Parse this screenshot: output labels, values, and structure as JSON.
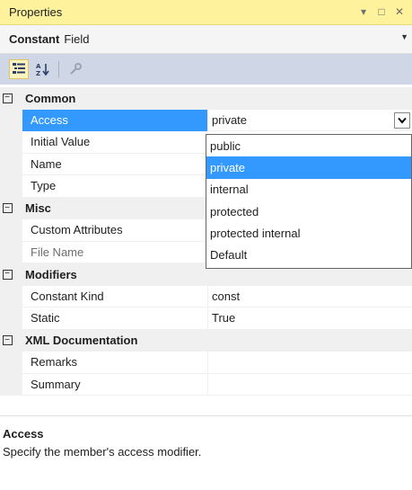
{
  "window": {
    "title": "Properties",
    "buttons": {
      "dropdown": "▾",
      "maximize": "□",
      "close": "✕"
    }
  },
  "object": {
    "name": "Constant",
    "type": "Field"
  },
  "toolbar": {
    "icons": [
      "categorized-icon",
      "alphabetical-icon",
      "property-pages-icon"
    ]
  },
  "grid": {
    "common": {
      "label": "Common",
      "access": {
        "name": "Access",
        "value": "private"
      },
      "initial_value": {
        "name": "Initial Value",
        "value": ""
      },
      "name": {
        "name": "Name",
        "value": ""
      },
      "type": {
        "name": "Type",
        "value": ""
      }
    },
    "misc": {
      "label": "Misc",
      "custom_attributes": {
        "name": "Custom Attributes",
        "value": ""
      },
      "file_name": {
        "name": "File Name",
        "value": ""
      }
    },
    "modifiers": {
      "label": "Modifiers",
      "constant_kind": {
        "name": "Constant Kind",
        "value": "const"
      },
      "static": {
        "name": "Static",
        "value": "True"
      }
    },
    "xml_documentation": {
      "label": "XML Documentation",
      "remarks": {
        "name": "Remarks",
        "value": ""
      },
      "summary": {
        "name": "Summary",
        "value": ""
      }
    }
  },
  "dropdown": {
    "options": [
      "public",
      "private",
      "internal",
      "protected",
      "protected internal",
      "Default"
    ],
    "selected": "private"
  },
  "description": {
    "title": "Access",
    "text": "Specify the member's access modifier."
  },
  "colors": {
    "selection": "#3399ff",
    "title_bar": "#fff29d",
    "toolbar": "#cfd6e5"
  }
}
